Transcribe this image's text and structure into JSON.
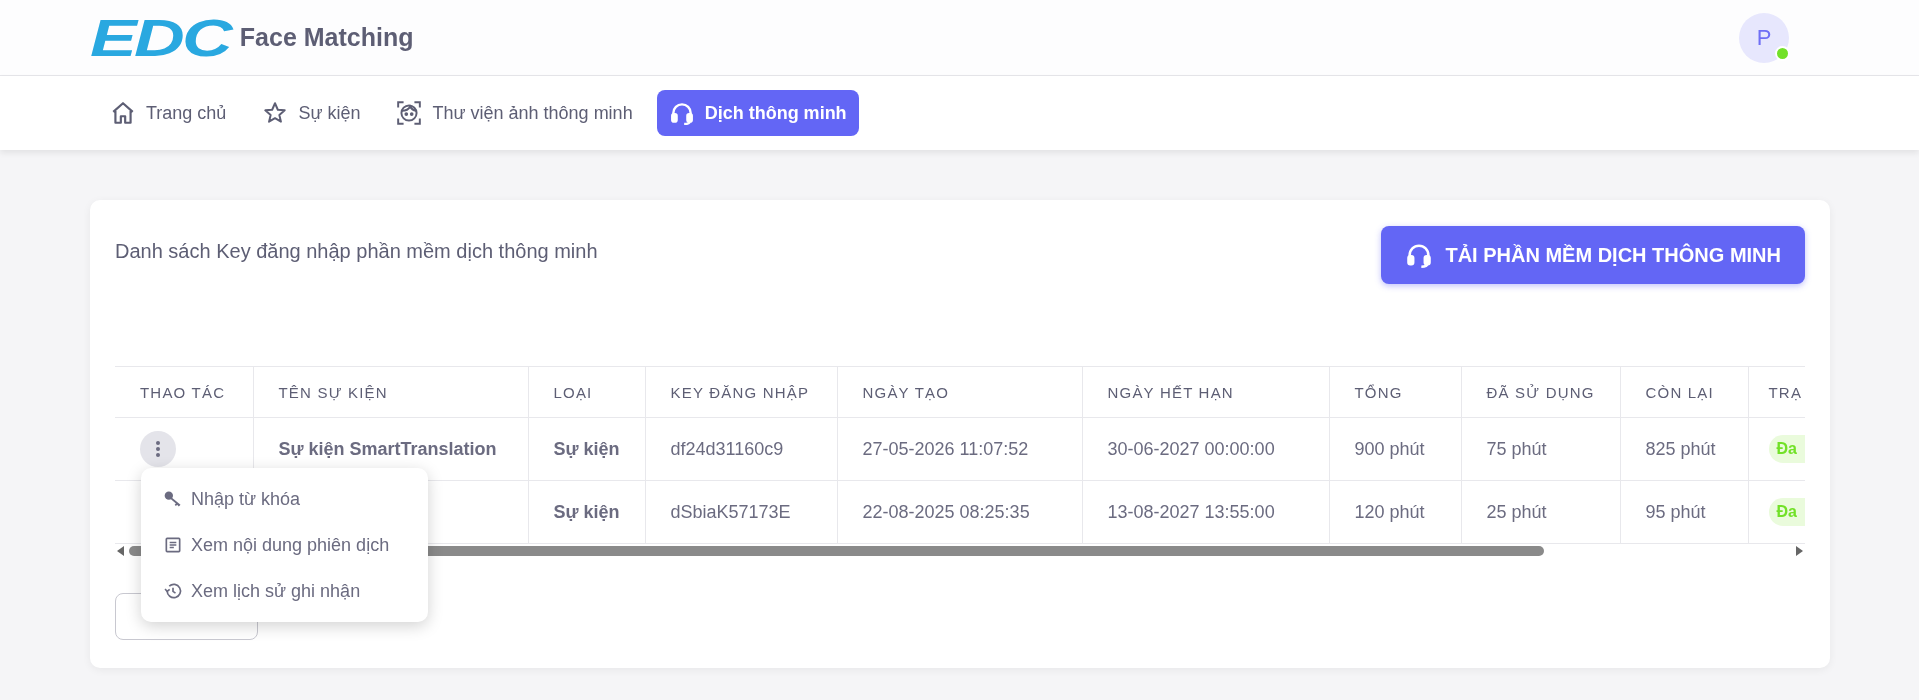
{
  "header": {
    "logo": "EDC",
    "title": "Face Matching",
    "avatar": "P",
    "online": true
  },
  "nav": [
    {
      "label": "Trang chủ",
      "kind": "home",
      "selected": false
    },
    {
      "label": "Sự kiện",
      "kind": "events",
      "selected": false
    },
    {
      "label": "Thư viện ảnh thông minh",
      "kind": "gallery",
      "selected": false
    },
    {
      "label": "Dịch thông minh",
      "kind": "translate",
      "selected": true
    }
  ],
  "card": {
    "title": "Danh sách Key đăng nhập phần mềm dịch thông minh",
    "download_button": "TẢI PHẦN MỀM DỊCH THÔNG MINH"
  },
  "table": {
    "columns": [
      "THAO TÁC",
      "TÊN SỰ KIỆN",
      "LOẠI",
      "KEY ĐĂNG NHẬP",
      "NGÀY TẠO",
      "NGÀY HẾT HẠN",
      "TỔNG",
      "ĐÃ SỬ DỤNG",
      "CÒN LẠI",
      "TRẠ"
    ],
    "rows": [
      {
        "name": "Sự kiện SmartTranslation",
        "type": "Sự kiện",
        "key": "df24d31160c9",
        "created": "27-05-2026 11:07:52",
        "expires": "30-06-2027 00:00:00",
        "total": "900 phút",
        "used": "75 phút",
        "remaining": "825 phút",
        "status": "Đa",
        "menu_open": true
      },
      {
        "type": "Sự kiện",
        "key": "dSbiaK57173E",
        "created": "22-08-2025 08:25:35",
        "expires": "13-08-2027 13:55:00",
        "total": "120 phút",
        "used": "25 phút",
        "remaining": "95 phút",
        "status": "Đa",
        "menu_open": false
      }
    ]
  },
  "action_menu": [
    {
      "label": "Nhập từ khóa",
      "kind": "keywords"
    },
    {
      "label": "Xem nội dung phiên dịch",
      "kind": "content"
    },
    {
      "label": "Xem lịch sử ghi nhận",
      "kind": "history"
    }
  ]
}
